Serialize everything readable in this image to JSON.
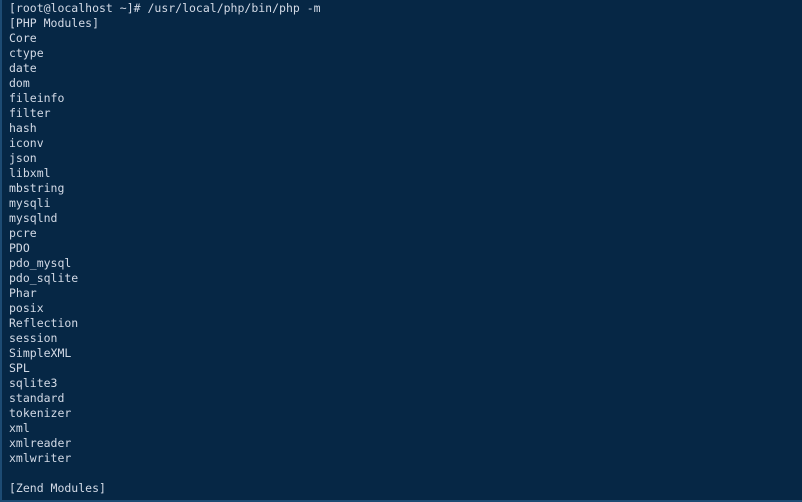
{
  "terminal": {
    "colors": {
      "background": "#062745",
      "foreground": "#d3dae6",
      "border": "#1d4b73"
    },
    "prompt": {
      "user": "root",
      "host": "localhost",
      "cwd": "~",
      "symbol": "#",
      "text": "[root@localhost ~]#"
    },
    "command": "/usr/local/php/bin/php -m",
    "lines": [
      "[root@localhost ~]# /usr/local/php/bin/php -m",
      "[PHP Modules]",
      "Core",
      "ctype",
      "date",
      "dom",
      "fileinfo",
      "filter",
      "hash",
      "iconv",
      "json",
      "libxml",
      "mbstring",
      "mysqli",
      "mysqlnd",
      "pcre",
      "PDO",
      "pdo_mysql",
      "pdo_sqlite",
      "Phar",
      "posix",
      "Reflection",
      "session",
      "SimpleXML",
      "SPL",
      "sqlite3",
      "standard",
      "tokenizer",
      "xml",
      "xmlreader",
      "xmlwriter",
      "",
      "[Zend Modules]"
    ],
    "sections": {
      "php_modules_header": "[PHP Modules]",
      "zend_modules_header": "[Zend Modules]",
      "php_modules": [
        "Core",
        "ctype",
        "date",
        "dom",
        "fileinfo",
        "filter",
        "hash",
        "iconv",
        "json",
        "libxml",
        "mbstring",
        "mysqli",
        "mysqlnd",
        "pcre",
        "PDO",
        "pdo_mysql",
        "pdo_sqlite",
        "Phar",
        "posix",
        "Reflection",
        "session",
        "SimpleXML",
        "SPL",
        "sqlite3",
        "standard",
        "tokenizer",
        "xml",
        "xmlreader",
        "xmlwriter"
      ],
      "zend_modules": []
    }
  }
}
